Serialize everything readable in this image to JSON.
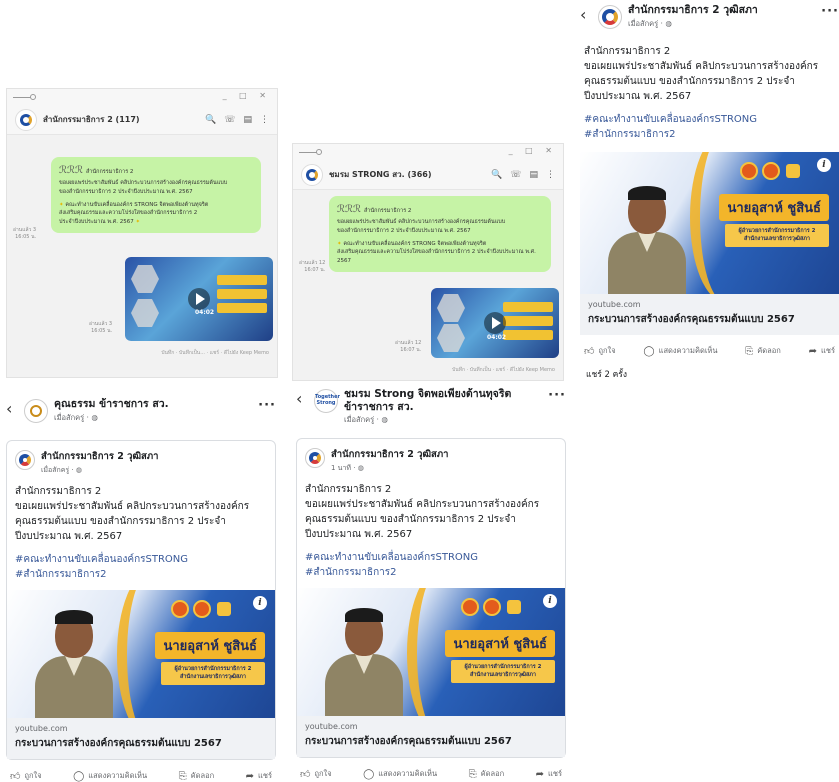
{
  "chat1": {
    "name": "สำนักกรรมาธิการ 2 (117)",
    "bubble_header": "สำนักกรรมาธิการ 2",
    "bubble_lines": [
      "ขอเผยแพร่ประชาสัมพันธ์ คลิปกระบวนการสร้างองค์กรคุณธรรมต้นแบบ",
      "ของสำนักกรรมาธิการ 2 ประจำปีงบประมาณ พ.ศ. 2567"
    ],
    "bubble_extra": [
      "คณะทำงานขับเคลื่อนองค์กร STRONG จิตพอเพียงต้านทุจริต",
      "ส่งเสริมคุณธรรมและความโปร่งใสของสำนักกรรมาธิการ 2",
      "ประจำปีงบประมาณ พ.ศ. 2567"
    ],
    "msg_time": "อ่านแล้ว 3\n16:05 น.",
    "video_time": "อ่านแล้ว 3\n16:05 น.",
    "duration": "04:02",
    "footer": "บันทึก · บันทึกเป็น... · แชร์ · ดีไปยัง Keep Memo"
  },
  "chat2": {
    "name": "ชมรม STRONG สว. (366)",
    "bubble_header": "สำนักกรรมาธิการ 2",
    "bubble_lines": [
      "ขอเผยแพร่ประชาสัมพันธ์ คลิปกระบวนการสร้างองค์กรคุณธรรมต้นแบบ",
      "ของสำนักกรรมาธิการ 2 ประจำปีงบประมาณ พ.ศ. 2567"
    ],
    "bubble_extra": [
      "คณะทำงานขับเคลื่อนองค์กร STRONG จิตพอเพียงต้านทุจริต",
      "ส่งเสริมคุณธรรมและความโปร่งใสของสำนักกรรมาธิการ 2 ประจำปีงบประมาณ พ.ศ. 2567"
    ],
    "msg_time": "อ่านแล้ว 12\n16:07 น.",
    "video_time": "อ่านแล้ว 12\n16:07 น.",
    "duration": "04:02",
    "footer": "บันทึก · บันทึกเป็น · แชร์ · ดีไปยัง Keep Memo"
  },
  "post": {
    "text_lines": [
      "สำนักกรรมาธิการ 2",
      "ขอเผยแพร่ประชาสัมพันธ์ คลิปกระบวนการสร้างองค์กร",
      "คุณธรรมต้นแบบ ของสำนักกรรมาธิการ 2 ประจำ",
      "ปีงบประมาณ พ.ศ. 2567"
    ],
    "hashtags": [
      "#คณะทำงานขับเคลื่อนองค์กรSTRONG",
      "#สำนักกรรมาธิการ2"
    ],
    "banner_name": "นายอุสาห์ ชูสินธ์",
    "banner_role": "ผู้อำนวยการสำนักกรรมาธิการ 2\nสำนักงานเลขาธิการวุฒิสภา",
    "link_domain": "youtube.com",
    "link_title": "กระบวนการสร้างองค์กรคุณธรรมต้นแบบ 2567",
    "actions": {
      "like": "ถูกใจ",
      "comment": "แสดงความคิดเห็น",
      "copy": "คัดลอก",
      "share": "แชร์"
    }
  },
  "fbA": {
    "page_name": "คุณธรรม ข้าราชการ สว.",
    "page_sub": "เมื่อสักครู่ ·",
    "share_name": "สำนักกรรมาธิการ 2 วุฒิสภา",
    "share_time": "เมื่อสักครู่ ·"
  },
  "fbB": {
    "page_name_line1": "ชมรม Strong จิตพอเพียงต้านทุจริต",
    "page_name_line2": "ข้าราชการ สว.",
    "page_sub": "เมื่อสักครู่ ·",
    "avatar_text": "Together Strong",
    "share_name": "สำนักกรรมาธิการ 2 วุฒิสภา",
    "share_time": "1 นาที ·"
  },
  "fbC": {
    "page_name": "สำนักกรรมาธิการ 2 วุฒิสภา",
    "page_sub": "เมื่อสักครู่ ·",
    "share_count": "แชร์ 2 ครั้ง"
  },
  "colors": {
    "bubble": "#c6f3a6",
    "hashtag": "#385898",
    "banner_blue": "#2960b8",
    "banner_gold": "#f3b52a"
  }
}
